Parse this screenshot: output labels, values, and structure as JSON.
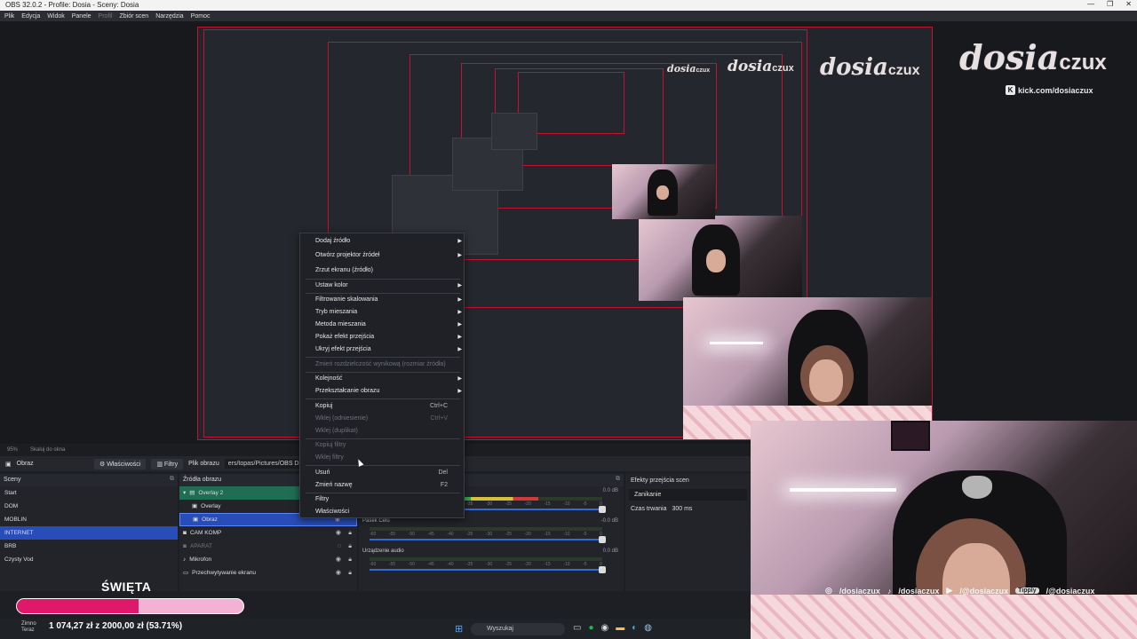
{
  "window": {
    "title": "OBS 32.0.2 - Profile: Dosia - Sceny: Dosia",
    "minimize": "—",
    "maximize": "❐",
    "close": "✕"
  },
  "menu": [
    "Plik",
    "Edycja",
    "Widok",
    "Panele",
    "Profil",
    "Zbiór scen",
    "Narzędzia",
    "Pomoc"
  ],
  "brand": {
    "logo_main": "dosia",
    "logo_sub": "czux",
    "kick_handle": "kick.com/dosiaczux",
    "socials": [
      "/dosiaczux",
      "/dosiaczux",
      "/@dosiaczux",
      "/@dosiaczux"
    ],
    "tipply": "Tipply"
  },
  "context_menu": {
    "items": [
      {
        "label": "Dodaj źródło",
        "submenu": true
      },
      {
        "label": "Otwórz projektor źródeł",
        "submenu": true
      },
      {
        "label": "Zrzut ekranu (źródło)"
      },
      {
        "label": "Ustaw kolor",
        "submenu": true
      },
      {
        "label": "Filtrowanie skalowania",
        "submenu": true
      },
      {
        "label": "Tryb mieszania",
        "submenu": true
      },
      {
        "label": "Metoda mieszania",
        "submenu": true
      },
      {
        "label": "Pokaż efekt przejścia",
        "submenu": true
      },
      {
        "label": "Ukryj efekt przejścia",
        "submenu": true
      },
      {
        "label": "Zmień rozdzielczość wynikową (rozmiar źródła)",
        "disabled": true
      },
      {
        "label": "Kolejność",
        "submenu": true
      },
      {
        "label": "Przekształcanie obrazu",
        "submenu": true
      },
      {
        "label": "Kopiuj",
        "shortcut": "Ctrl+C"
      },
      {
        "label": "Wklej (odniesienie)",
        "shortcut": "Ctrl+V",
        "disabled": true
      },
      {
        "label": "Wklej (duplikat)",
        "disabled": true
      },
      {
        "label": "Kopiuj filtry",
        "disabled": true
      },
      {
        "label": "Wklej filtry",
        "disabled": true
      },
      {
        "label": "Usuń",
        "shortcut": "Del"
      },
      {
        "label": "Zmień nazwę",
        "shortcut": "F2"
      },
      {
        "label": "Filtry"
      },
      {
        "label": "Właściwości"
      }
    ]
  },
  "status": {
    "zoom": "95%",
    "fit": "Skaluj do okna"
  },
  "toolbar": {
    "source": "Obraz",
    "properties": "Właściwości",
    "filters": "Filtry",
    "file_label": "Plik obrazu",
    "path": "ers/topas/Pictures/OBS DOS"
  },
  "scenes": {
    "title": "Sceny",
    "items": [
      "Start",
      "DOM",
      "MOBLIN",
      "INTERNET",
      "BRB",
      "Czysty Vod"
    ],
    "selected": 3
  },
  "sources": {
    "title": "Źródła obrazu",
    "items": [
      {
        "label": "Overlay 2",
        "group": true
      },
      {
        "label": "Overlay"
      },
      {
        "label": "Obraz",
        "selected": true
      },
      {
        "label": "CAM KOMP"
      },
      {
        "label": "APARAT",
        "dim": true
      },
      {
        "label": "Mikrofon"
      },
      {
        "label": "Przechwytywanie ekranu"
      }
    ]
  },
  "mixer": {
    "channels": [
      {
        "name": "",
        "db": "0.0 dB",
        "level": 0.72
      },
      {
        "name": "Pasek Celu",
        "db": "-0.0 dB",
        "level": 0
      },
      {
        "name": "Urządzenie audio",
        "db": "0.0 dB",
        "level": 0
      }
    ],
    "ticks": [
      "-60",
      "-55",
      "-50",
      "-45",
      "-40",
      "-35",
      "-30",
      "-25",
      "-20",
      "-15",
      "-10",
      "-5",
      "0"
    ]
  },
  "transitions": {
    "title": "Efekty przejścia scen",
    "type": "Zanikanie",
    "duration_label": "Czas trwania",
    "duration": "300 ms"
  },
  "goal": {
    "title": "ŚWIĘTA",
    "text": "1 074,27 zł z 2000,00 zł (53.71%)",
    "percent": 53.71
  },
  "taskbar": {
    "weather_temp": "Zimno",
    "weather_desc": "Teraz",
    "search": "Wyszukaj"
  },
  "colors": {
    "accent": "#284cb8",
    "selection_red": "#c4122f",
    "goal_fill": "#e0186c",
    "goal_bg": "#f3b2d4"
  }
}
